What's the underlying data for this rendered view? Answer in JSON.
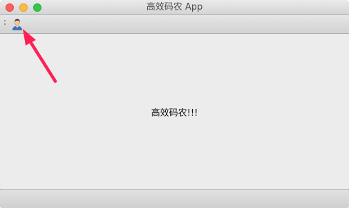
{
  "window": {
    "title": "高效码农 App"
  },
  "toolbar": {
    "items": [
      {
        "icon": "user-icon"
      }
    ]
  },
  "content": {
    "message": "高效码农!!!"
  },
  "colors": {
    "close": "#fc605c",
    "minimize": "#fdbc40",
    "maximize": "#34c84a",
    "annotation_arrow": "#ff1f55"
  }
}
